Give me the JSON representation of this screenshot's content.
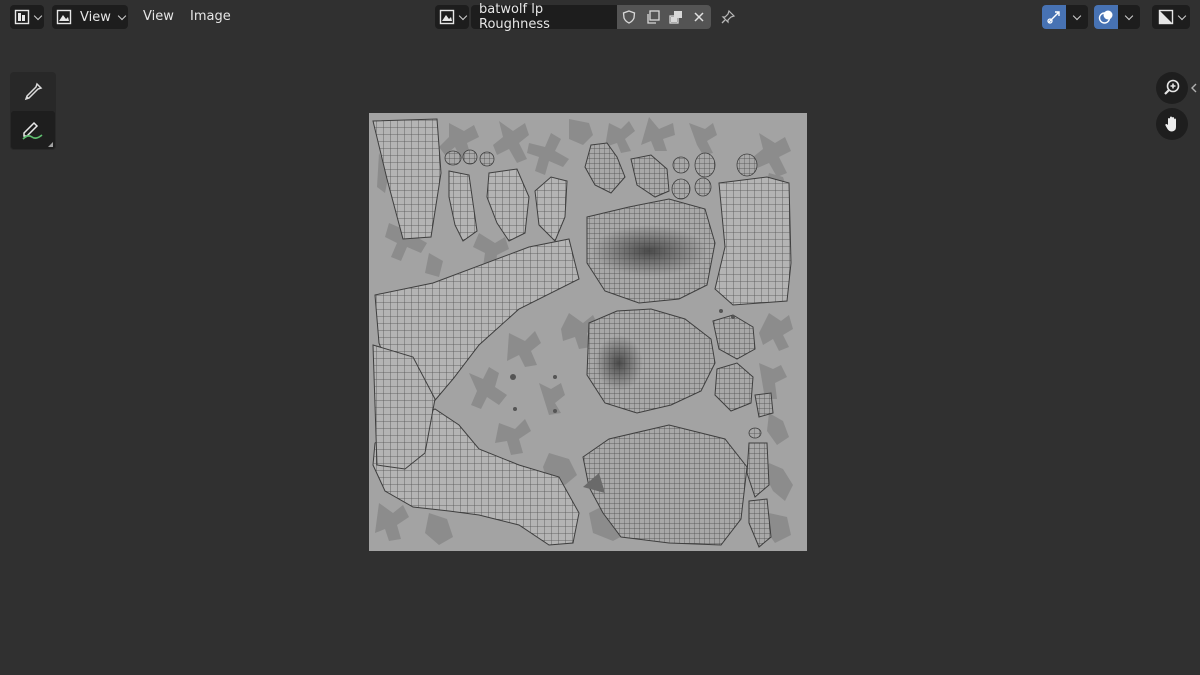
{
  "header": {
    "editor_type_icon": "image-editor-icon",
    "view_mode_icon": "image-view-icon",
    "view_mode_label": "View",
    "menus": [
      {
        "label": "View"
      },
      {
        "label": "Image"
      }
    ],
    "image_browse_icon": "image-browse-icon",
    "image_name": "batwolf lp Roughness",
    "image_actions": [
      "fake-user-shield-icon",
      "new-image-icon",
      "open-image-icon",
      "unlink-close-icon"
    ],
    "pin_icon": "pin-icon",
    "gizmo_icon": "gizmo-icon",
    "overlay_icon": "overlay-icon",
    "display_channels_icon": "display-channels-icon"
  },
  "toolbar": {
    "tools": [
      {
        "name": "sample-tool",
        "icon": "eyedropper-icon",
        "active": false
      },
      {
        "name": "annotate-tool",
        "icon": "annotate-pencil-icon",
        "active": true
      }
    ]
  },
  "navigation": {
    "zoom_icon": "zoom-icon",
    "pan_icon": "hand-pan-icon"
  },
  "image": {
    "content": "uv-wireframe-roughness-map",
    "background_color": "#a3a3a3"
  },
  "colors": {
    "background": "#303030",
    "header_button": "#1d1d1d",
    "accent": "#4772b3"
  }
}
